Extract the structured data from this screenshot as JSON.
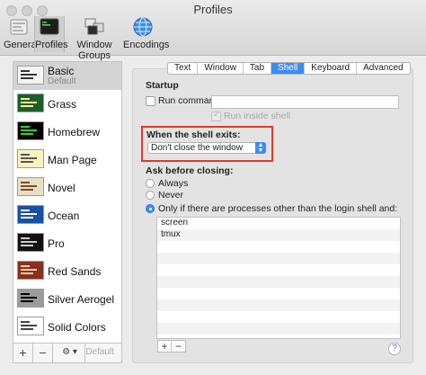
{
  "window": {
    "title": "Profiles"
  },
  "toolbar": {
    "items": [
      {
        "label": "General",
        "icon": "general-icon"
      },
      {
        "label": "Profiles",
        "icon": "profiles-icon",
        "selected": true
      },
      {
        "label": "Window Groups",
        "icon": "window-groups-icon"
      },
      {
        "label": "Encodings",
        "icon": "encodings-icon"
      }
    ]
  },
  "profiles": {
    "items": [
      {
        "name": "Basic",
        "sub": "Default",
        "bg": "#f4f4f4",
        "fg": "#333333",
        "selected": true
      },
      {
        "name": "Grass",
        "bg": "#1b5e2a",
        "fg": "#ffef8f"
      },
      {
        "name": "Homebrew",
        "bg": "#000000",
        "fg": "#2dd42d"
      },
      {
        "name": "Man Page",
        "bg": "#fdf2bf",
        "fg": "#555555"
      },
      {
        "name": "Novel",
        "bg": "#e9dfc7",
        "fg": "#7a4e2a"
      },
      {
        "name": "Ocean",
        "bg": "#1a4fa6",
        "fg": "#ffffff"
      },
      {
        "name": "Pro",
        "bg": "#111111",
        "fg": "#cccccc"
      },
      {
        "name": "Red Sands",
        "bg": "#8b2f1f",
        "fg": "#e8d5a8"
      },
      {
        "name": "Silver Aerogel",
        "bg": "#9b9b9b",
        "fg": "#000000"
      },
      {
        "name": "Solid Colors",
        "bg": "#ffffff",
        "fg": "#444444"
      }
    ],
    "bottom_bar": {
      "add": "+",
      "remove": "−",
      "gear": "⚙ ▾",
      "default": "Default"
    }
  },
  "tabs": [
    {
      "label": "Text"
    },
    {
      "label": "Window"
    },
    {
      "label": "Tab"
    },
    {
      "label": "Shell",
      "active": true
    },
    {
      "label": "Keyboard"
    },
    {
      "label": "Advanced"
    }
  ],
  "shell": {
    "startup_heading": "Startup",
    "run_command_label": "Run command:",
    "run_command_value": "",
    "run_inside_shell_label": "Run inside shell",
    "when_exits_heading": "When the shell exits:",
    "when_exits_value": "Don't close the window",
    "ask_heading": "Ask before closing:",
    "options": [
      {
        "label": "Always",
        "selected": false
      },
      {
        "label": "Never",
        "selected": false
      },
      {
        "label": "Only if there are processes other than the login shell and:",
        "selected": true
      }
    ],
    "processes": [
      "screen",
      "tmux"
    ],
    "add": "+",
    "remove": "−",
    "help": "?"
  },
  "colors": {
    "accent": "#3d8cf5",
    "highlight_border": "#e2382c"
  }
}
